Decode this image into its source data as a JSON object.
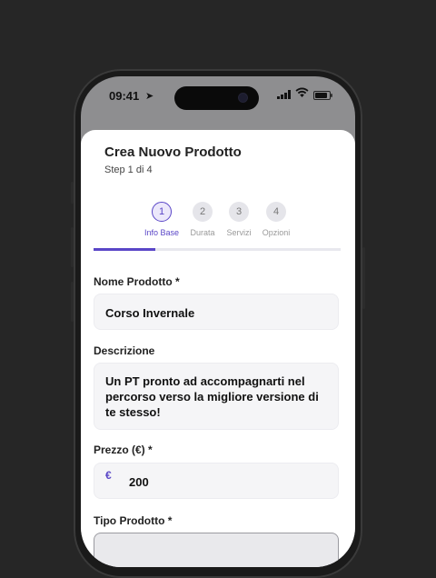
{
  "status_bar": {
    "time": "09:41"
  },
  "header": {
    "title": "Crea Nuovo Prodotto",
    "subtitle": "Step 1 di 4"
  },
  "steps": [
    {
      "number": "1",
      "label": "Info Base",
      "active": true
    },
    {
      "number": "2",
      "label": "Durata",
      "active": false
    },
    {
      "number": "3",
      "label": "Servizi",
      "active": false
    },
    {
      "number": "4",
      "label": "Opzioni",
      "active": false
    }
  ],
  "progress": {
    "fraction": 0.25
  },
  "form": {
    "name_label": "Nome Prodotto *",
    "name_value": "Corso Invernale",
    "description_label": "Descrizione",
    "description_value": "Un PT pronto ad accompagnarti nel percorso verso la migliore versione di te stesso!",
    "price_label": "Prezzo (€) *",
    "price_currency": "€",
    "price_value": "200",
    "type_label": "Tipo Prodotto *",
    "type_value": ""
  },
  "colors": {
    "accent": "#5a46c7",
    "background": "#262626"
  }
}
